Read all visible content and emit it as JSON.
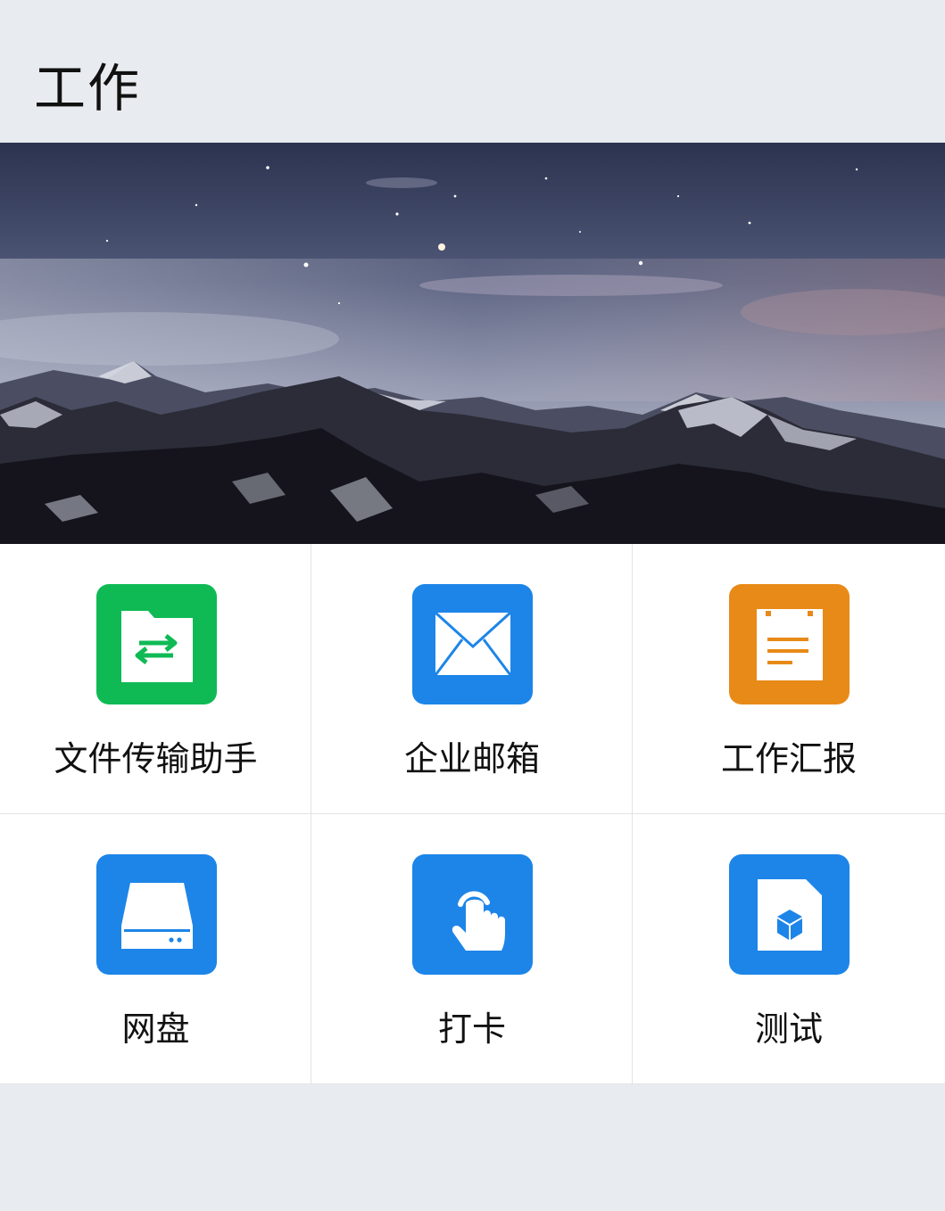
{
  "header": {
    "title": "工作"
  },
  "banner": {
    "image": "night-mountain-landscape"
  },
  "apps": [
    {
      "label": "文件传输助手",
      "icon": "file-transfer-icon",
      "color": "#0fba55"
    },
    {
      "label": "企业邮箱",
      "icon": "mail-icon",
      "color": "#1d85e8"
    },
    {
      "label": "工作汇报",
      "icon": "report-icon",
      "color": "#e88a18"
    },
    {
      "label": "网盘",
      "icon": "drive-icon",
      "color": "#1d85e8"
    },
    {
      "label": "打卡",
      "icon": "tap-hand-icon",
      "color": "#1d85e8"
    },
    {
      "label": "测试",
      "icon": "app-box-icon",
      "color": "#1d85e8"
    }
  ]
}
